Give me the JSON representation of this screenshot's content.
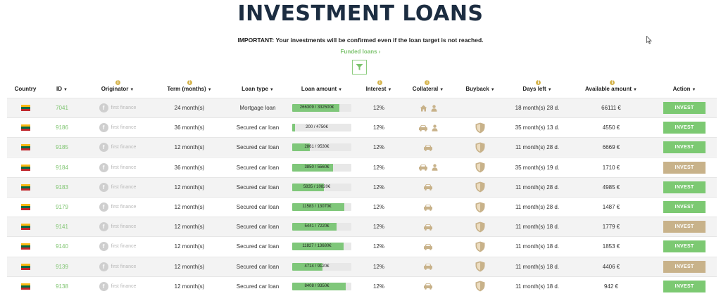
{
  "page": {
    "title": "INVESTMENT LOANS",
    "notice": "IMPORTANT: Your investments will be confirmed even if the loan target is not reached.",
    "funded_link": "Funded loans",
    "funded_chevron": "›"
  },
  "colors": {
    "accent_green": "#7cc36d",
    "button_green": "#7cc972",
    "button_tan": "#c8b28a",
    "icon_tan": "#c8b28a",
    "title": "#1c2d41"
  },
  "info_icon_glyph": "i",
  "columns": [
    {
      "key": "country",
      "label": "Country",
      "sortable": false
    },
    {
      "key": "id",
      "label": "ID",
      "sortable": true
    },
    {
      "key": "originator",
      "label": "Originator",
      "sortable": true
    },
    {
      "key": "term",
      "label": "Term (months)",
      "sortable": true
    },
    {
      "key": "loan_type",
      "label": "Loan type",
      "sortable": true
    },
    {
      "key": "loan_amount",
      "label": "Loan amount",
      "sortable": true
    },
    {
      "key": "interest",
      "label": "Interest",
      "sortable": true
    },
    {
      "key": "collateral",
      "label": "Collateral",
      "sortable": true
    },
    {
      "key": "buyback",
      "label": "Buyback",
      "sortable": true
    },
    {
      "key": "days_left",
      "label": "Days left",
      "sortable": true
    },
    {
      "key": "available",
      "label": "Available amount",
      "sortable": true
    },
    {
      "key": "action",
      "label": "Action",
      "sortable": true
    }
  ],
  "sort_arrow": "▼",
  "rows": [
    {
      "country": "Lithuania",
      "id": "7041",
      "originator": "first finance",
      "term": "24 month(s)",
      "loan_type": "Mortgage loan",
      "amount_text": "266309 / 332500€",
      "funded": 0.801,
      "interest": "12%",
      "collateral": [
        "home-icon",
        "person-icon"
      ],
      "buyback": false,
      "days_left": "18 month(s) 28 d.",
      "available": "66111 €",
      "action": "INVEST",
      "action_style": "green"
    },
    {
      "country": "Lithuania",
      "id": "9186",
      "originator": "first finance",
      "term": "36 month(s)",
      "loan_type": "Secured car loan",
      "amount_text": "200 / 4750€",
      "funded": 0.042,
      "interest": "12%",
      "collateral": [
        "car-icon",
        "person-icon"
      ],
      "buyback": true,
      "days_left": "35 month(s) 13 d.",
      "available": "4550 €",
      "action": "INVEST",
      "action_style": "green"
    },
    {
      "country": "Lithuania",
      "id": "9185",
      "originator": "first finance",
      "term": "12 month(s)",
      "loan_type": "Secured car loan",
      "amount_text": "2861 / 9530€",
      "funded": 0.3,
      "interest": "12%",
      "collateral": [
        "car-icon"
      ],
      "buyback": true,
      "days_left": "11 month(s) 28 d.",
      "available": "6669 €",
      "action": "INVEST",
      "action_style": "green"
    },
    {
      "country": "Lithuania",
      "id": "9184",
      "originator": "first finance",
      "term": "36 month(s)",
      "loan_type": "Secured car loan",
      "amount_text": "3850 / 5560€",
      "funded": 0.692,
      "interest": "12%",
      "collateral": [
        "car-icon",
        "person-icon"
      ],
      "buyback": true,
      "days_left": "35 month(s) 19 d.",
      "available": "1710 €",
      "action": "INVEST",
      "action_style": "tan"
    },
    {
      "country": "Lithuania",
      "id": "9183",
      "originator": "first finance",
      "term": "12 month(s)",
      "loan_type": "Secured car loan",
      "amount_text": "5835 / 10820€",
      "funded": 0.539,
      "interest": "12%",
      "collateral": [
        "car-icon"
      ],
      "buyback": true,
      "days_left": "11 month(s) 28 d.",
      "available": "4985 €",
      "action": "INVEST",
      "action_style": "green"
    },
    {
      "country": "Lithuania",
      "id": "9179",
      "originator": "first finance",
      "term": "12 month(s)",
      "loan_type": "Secured car loan",
      "amount_text": "11583 / 13070€",
      "funded": 0.886,
      "interest": "12%",
      "collateral": [
        "car-icon"
      ],
      "buyback": true,
      "days_left": "11 month(s) 28 d.",
      "available": "1487 €",
      "action": "INVEST",
      "action_style": "green"
    },
    {
      "country": "Lithuania",
      "id": "9141",
      "originator": "first finance",
      "term": "12 month(s)",
      "loan_type": "Secured car loan",
      "amount_text": "5441 / 7220€",
      "funded": 0.754,
      "interest": "12%",
      "collateral": [
        "car-icon"
      ],
      "buyback": true,
      "days_left": "11 month(s) 18 d.",
      "available": "1779 €",
      "action": "INVEST",
      "action_style": "tan"
    },
    {
      "country": "Lithuania",
      "id": "9140",
      "originator": "first finance",
      "term": "12 month(s)",
      "loan_type": "Secured car loan",
      "amount_text": "11827 / 13680€",
      "funded": 0.865,
      "interest": "12%",
      "collateral": [
        "car-icon"
      ],
      "buyback": true,
      "days_left": "11 month(s) 18 d.",
      "available": "1853 €",
      "action": "INVEST",
      "action_style": "green"
    },
    {
      "country": "Lithuania",
      "id": "9139",
      "originator": "first finance",
      "term": "12 month(s)",
      "loan_type": "Secured car loan",
      "amount_text": "4714 / 9120€",
      "funded": 0.517,
      "interest": "12%",
      "collateral": [
        "car-icon"
      ],
      "buyback": true,
      "days_left": "11 month(s) 18 d.",
      "available": "4406 €",
      "action": "INVEST",
      "action_style": "tan"
    },
    {
      "country": "Lithuania",
      "id": "9138",
      "originator": "first finance",
      "term": "12 month(s)",
      "loan_type": "Secured car loan",
      "amount_text": "8408 / 9350€",
      "funded": 0.899,
      "interest": "12%",
      "collateral": [
        "car-icon"
      ],
      "buyback": true,
      "days_left": "11 month(s) 18 d.",
      "available": "942 €",
      "action": "INVEST",
      "action_style": "green"
    }
  ]
}
